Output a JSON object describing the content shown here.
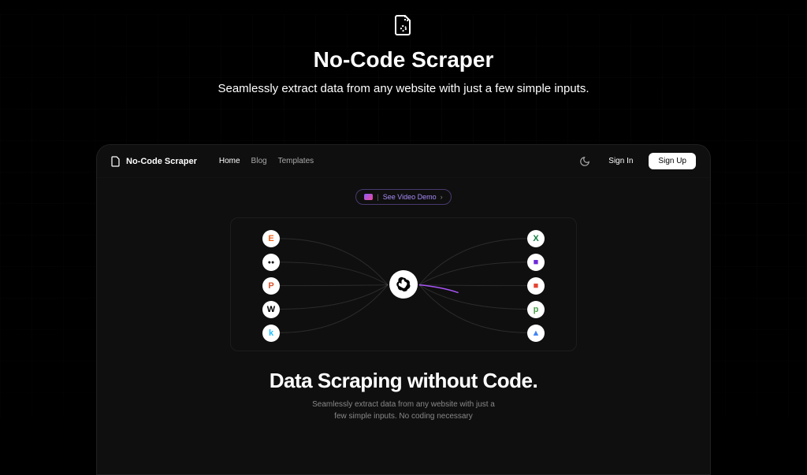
{
  "outer": {
    "title": "No-Code Scraper",
    "subtitle": "Seamlessly extract data from any website with just a few simple inputs."
  },
  "nav": {
    "brand": "No-Code Scraper",
    "links": [
      "Home",
      "Blog",
      "Templates"
    ],
    "signin": "Sign In",
    "signup": "Sign Up"
  },
  "demo": {
    "label": "See Video Demo",
    "separator": "|",
    "chevron": "›"
  },
  "viz": {
    "left_icons": [
      {
        "name": "etsy",
        "char": "E",
        "color": "#f1641e"
      },
      {
        "name": "medium",
        "char": "●●",
        "color": "#000"
      },
      {
        "name": "producthunt",
        "char": "P",
        "color": "#da552f"
      },
      {
        "name": "wordpress",
        "char": "W",
        "color": "#000"
      },
      {
        "name": "kaggle",
        "char": "k",
        "color": "#20beff"
      }
    ],
    "right_icons": [
      {
        "name": "excel",
        "char": "X",
        "color": "#107c41"
      },
      {
        "name": "tool",
        "char": "■",
        "color": "#6d28d9"
      },
      {
        "name": "todoist",
        "char": "■",
        "color": "#e44332"
      },
      {
        "name": "slack",
        "char": "p",
        "color": "#4a9e4a"
      },
      {
        "name": "drive",
        "char": "▲",
        "color": "#4285f4"
      }
    ],
    "center": "openai"
  },
  "hero": {
    "title": "Data Scraping without Code.",
    "sub1": "Seamlessly extract data from any website with just a",
    "sub2": "few simple inputs. No coding necessary"
  }
}
